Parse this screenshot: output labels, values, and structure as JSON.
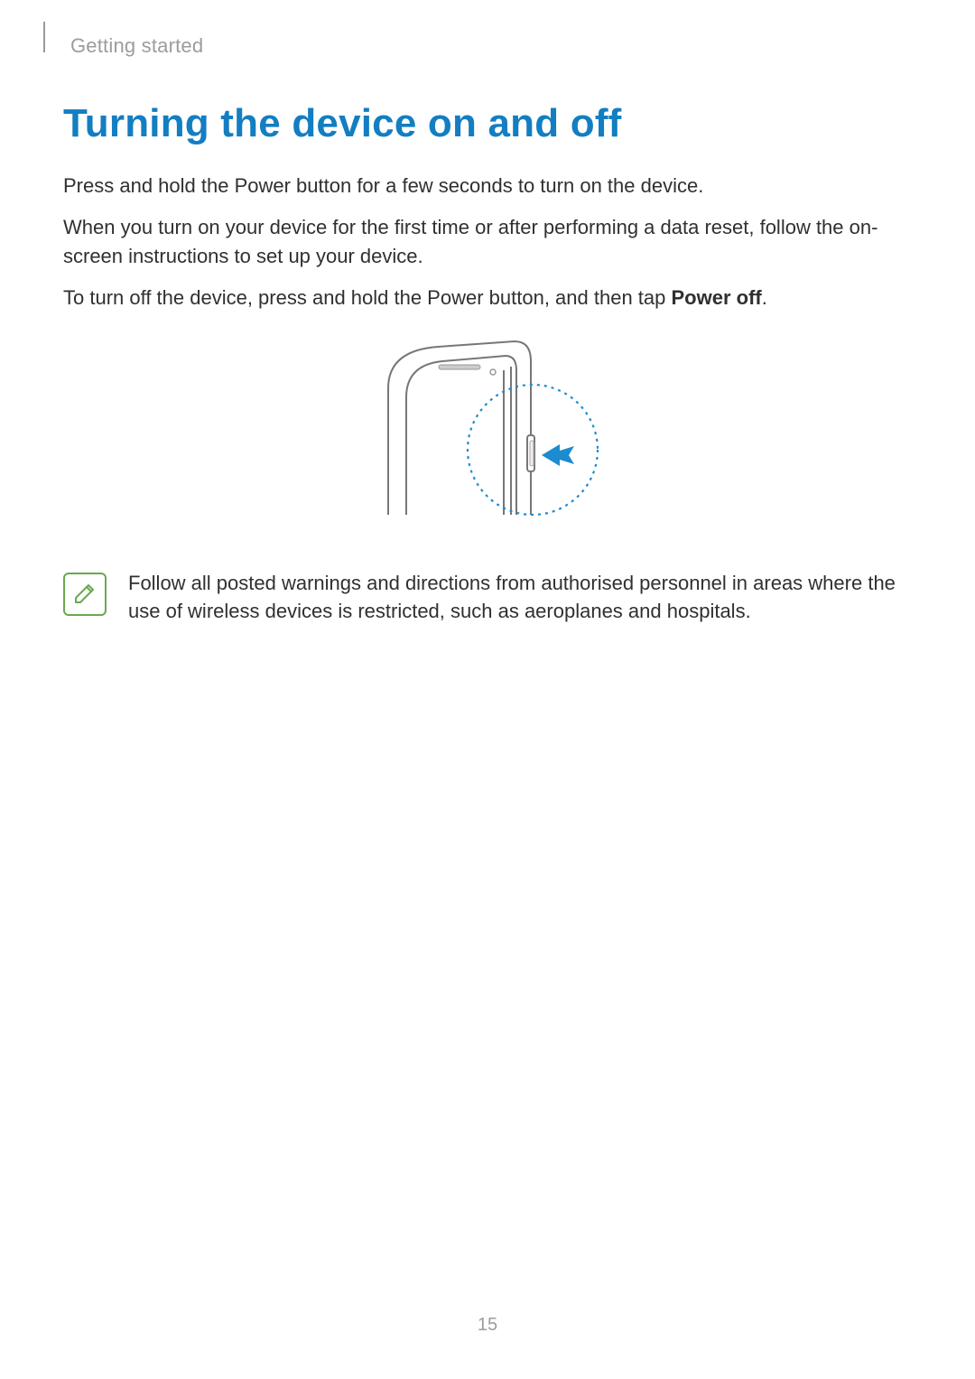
{
  "header": {
    "running_head": "Getting started"
  },
  "title": "Turning the device on and off",
  "paragraphs": {
    "p1": "Press and hold the Power button for a few seconds to turn on the device.",
    "p2": "When you turn on your device for the first time or after performing a data reset, follow the on-screen instructions to set up your device.",
    "p3_pre": "To turn off the device, press and hold the Power button, and then tap ",
    "p3_bold": "Power off",
    "p3_post": "."
  },
  "figure": {
    "alt": "Phone top corner showing Power button with arrow pressing it",
    "callout_color": "#1d8bcf",
    "dotted_circle_color": "#1d8bcf",
    "arrow_icon": "arrow-left-icon"
  },
  "note": {
    "icon": "note-pencil-icon",
    "text": "Follow all posted warnings and directions from authorised personnel in areas where the use of wireless devices is restricted, such as aeroplanes and hospitals."
  },
  "page_number": "15"
}
